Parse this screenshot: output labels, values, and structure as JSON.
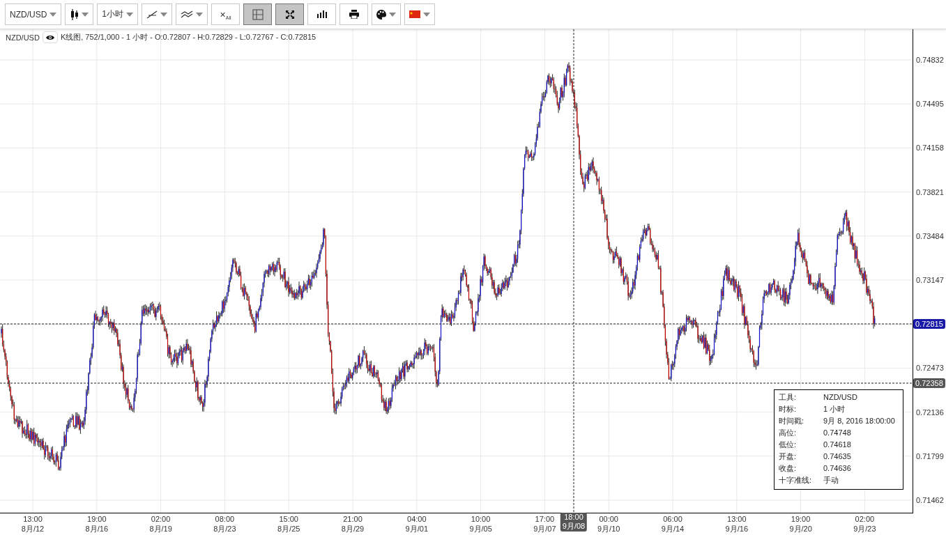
{
  "toolbar": [
    {
      "kind": "symbol",
      "label": "NZD/USD",
      "dropdown": true,
      "selected": false
    },
    {
      "kind": "chart-type",
      "dropdown": true,
      "selected": false
    },
    {
      "kind": "interval",
      "label": "1小时",
      "dropdown": true,
      "selected": false
    },
    {
      "kind": "draw",
      "dropdown": true,
      "selected": false
    },
    {
      "kind": "indicator",
      "dropdown": true,
      "selected": false
    },
    {
      "kind": "clear",
      "label": "×",
      "sub": "All",
      "dropdown": false,
      "selected": false
    },
    {
      "kind": "grid",
      "dropdown": false,
      "selected": true
    },
    {
      "kind": "fullscreen",
      "dropdown": false,
      "selected": true
    },
    {
      "kind": "volume",
      "dropdown": false,
      "selected": false
    },
    {
      "kind": "print",
      "dropdown": false,
      "selected": false
    },
    {
      "kind": "theme",
      "dropdown": true,
      "selected": false
    },
    {
      "kind": "language",
      "dropdown": true,
      "selected": false
    }
  ],
  "legend": {
    "symbol": "NZD/USD",
    "summary": "K线图, 752/1,000 - 1 小时 - O:0.72807 - H:0.72829 - L:0.72767 - C:0.72815"
  },
  "y_axis": [
    "0.74832",
    "0.74495",
    "0.74158",
    "0.73821",
    "0.73484",
    "0.73147",
    "0.72473",
    "0.72136",
    "0.71799",
    "0.71462"
  ],
  "price_markers": [
    {
      "kind": "last",
      "label": "0.72815",
      "color": "#1a1aa8"
    },
    {
      "kind": "line",
      "label": "0.72358",
      "color": "#555555"
    }
  ],
  "x_axis": [
    {
      "time": "13:00",
      "date": "8月/12"
    },
    {
      "time": "19:00",
      "date": "8月/16"
    },
    {
      "time": "02:00",
      "date": "8月/19"
    },
    {
      "time": "08:00",
      "date": "8月/23"
    },
    {
      "time": "15:00",
      "date": "8月/25"
    },
    {
      "time": "21:00",
      "date": "8月/29"
    },
    {
      "time": "04:00",
      "date": "9月/01"
    },
    {
      "time": "10:00",
      "date": "9月/05"
    },
    {
      "time": "17:00",
      "date": "9月/07"
    },
    {
      "time": "00:00",
      "date": "9月/10"
    },
    {
      "time": "06:00",
      "date": "9月/14"
    },
    {
      "time": "13:00",
      "date": "9月/16"
    },
    {
      "time": "19:00",
      "date": "9月/20"
    },
    {
      "time": "02:00",
      "date": "9月/23"
    }
  ],
  "crosshair": {
    "time": "18:00",
    "date": "9月/08"
  },
  "info_box": [
    {
      "label": "工具:",
      "value": "NZD/USD"
    },
    {
      "label": "时标:",
      "value": "1 小时"
    },
    {
      "label": "时间戳:",
      "value": "9月 8, 2016 18:00:00"
    },
    {
      "label": "高位:",
      "value": "0.74748"
    },
    {
      "label": "低位:",
      "value": "0.74618"
    },
    {
      "label": "开盘:",
      "value": "0.74635"
    },
    {
      "label": "收盘:",
      "value": "0.74636"
    },
    {
      "label": "十字准线:",
      "value": "手动"
    }
  ]
}
